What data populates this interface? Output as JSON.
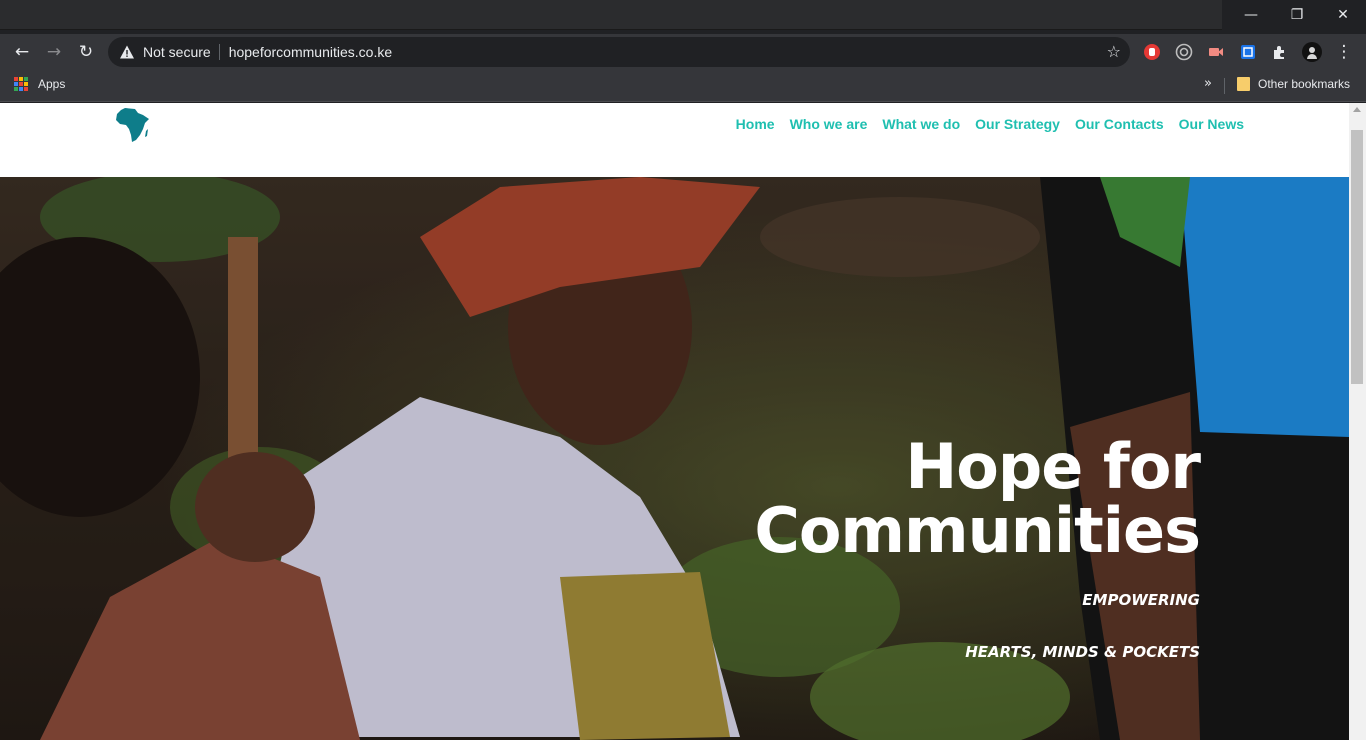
{
  "browser": {
    "security_label": "Not secure",
    "url": "hopeforcommunities.co.ke",
    "bookmarks": {
      "apps_label": "Apps",
      "other_label": "Other bookmarks"
    },
    "icons": [
      "back-icon",
      "forward-icon",
      "reload-icon",
      "warning-icon",
      "star-icon",
      "extensions-icon",
      "menu-icon",
      "minimize-icon",
      "restore-icon",
      "close-icon"
    ]
  },
  "site": {
    "nav": [
      {
        "label": "Home"
      },
      {
        "label": "Who we are"
      },
      {
        "label": "What we do"
      },
      {
        "label": "Our Strategy"
      },
      {
        "label": "Our Contacts"
      },
      {
        "label": "Our News"
      }
    ],
    "hero": {
      "title_line1": "Hope for",
      "title_line2": "Communities",
      "tagline_line1": "EMPOWERING",
      "tagline_line2": "HEARTS, MINDS & POCKETS"
    },
    "colors": {
      "accent": "#1fbfb0",
      "logo": "#0e7d8a"
    }
  }
}
